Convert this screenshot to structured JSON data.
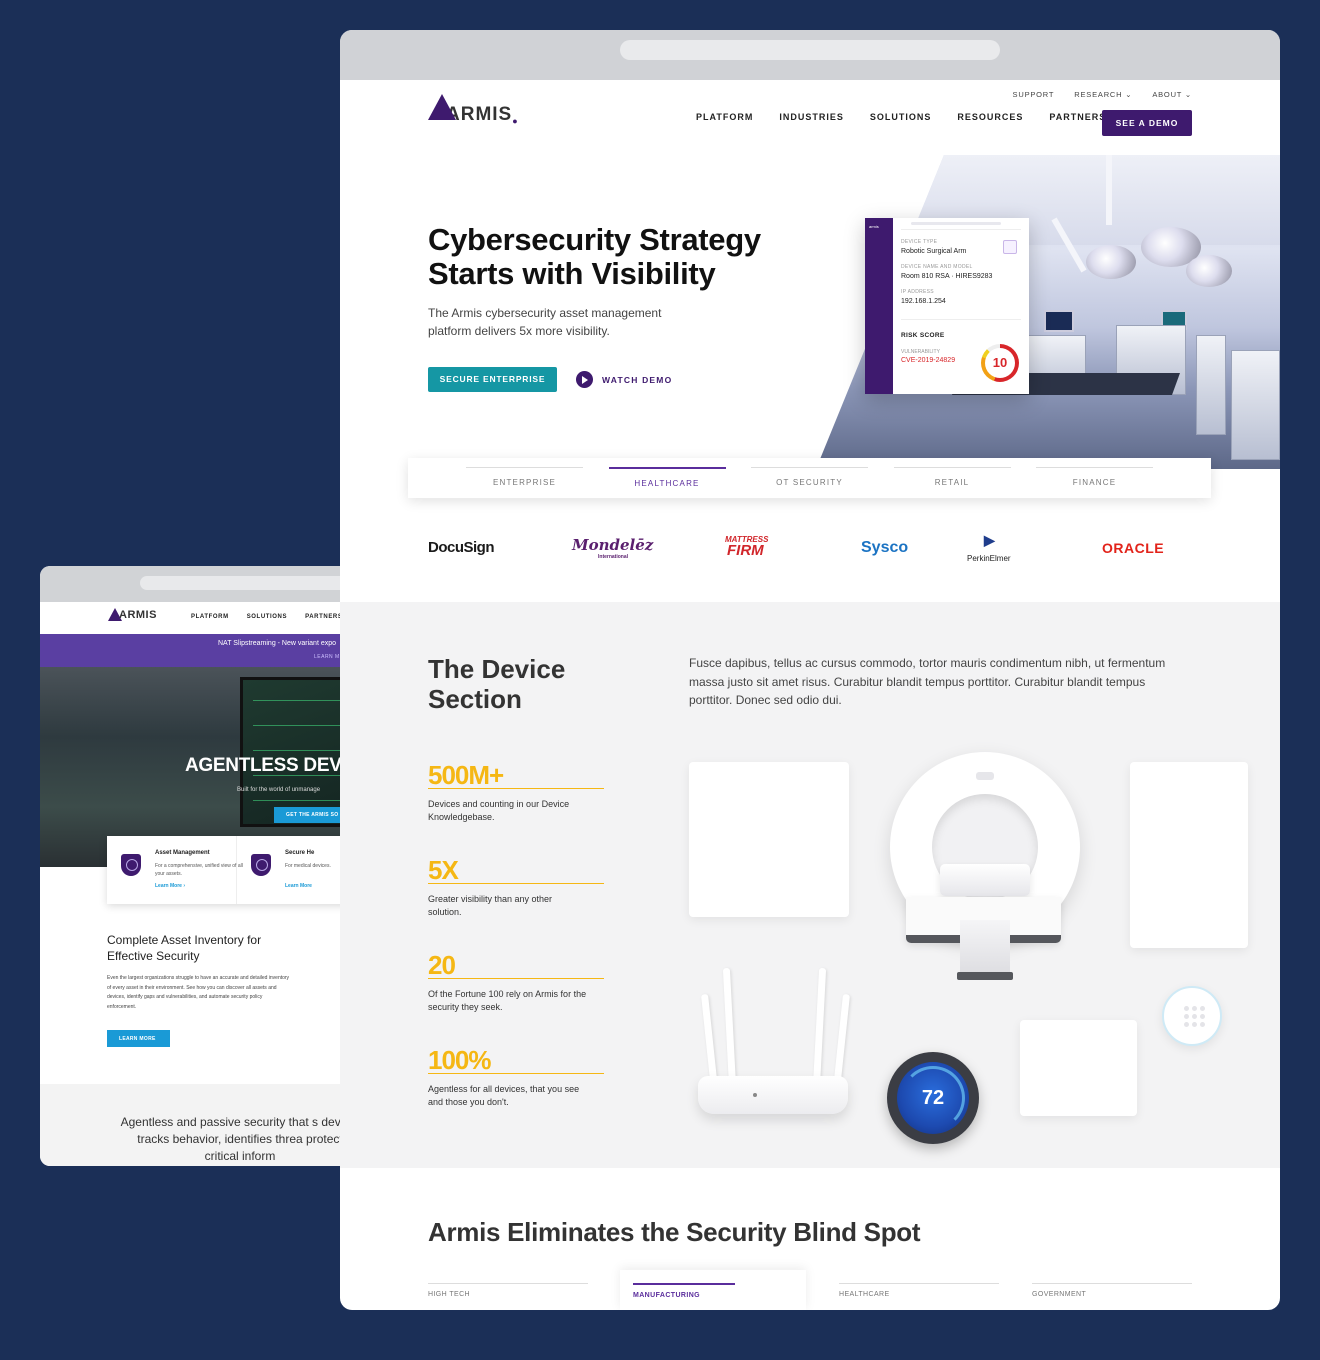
{
  "back_window": {
    "logo": "ARMIS",
    "nav": [
      "PLATFORM",
      "SOLUTIONS",
      "PARTNERS"
    ],
    "banner_text": "NAT Slipstreaming - New variant expo",
    "banner_link": "LEARN M",
    "hero_title": "AGENTLESS DEV",
    "hero_sub": "Built for the world of unmanage",
    "hero_cta": "GET THE ARMIS SO",
    "cards": [
      {
        "title": "Asset Management",
        "desc": "For a comprehensive, unified view of all your assets.",
        "link": "Learn More ›"
      },
      {
        "title": "Secure He",
        "desc": "For medical devices.",
        "link": "Learn More"
      }
    ],
    "body_title": "Complete Asset Inventory for Effective Security",
    "body_text": "Even the largest organizations struggle to have an accurate and detailed inventory of every asset in their environment. See how you can discover all assets and devices, identify gaps and vulnerabilities, and automate security policy enforcement.",
    "body_btn": "LEARN MORE",
    "footer_text": "Agentless and passive security that s device, tracks behavior, identifies threa protect critical inform"
  },
  "header": {
    "logo": "ARMIS",
    "utility": [
      "SUPPORT",
      "RESEARCH ⌄",
      "ABOUT ⌄"
    ],
    "nav": [
      "PLATFORM",
      "INDUSTRIES",
      "SOLUTIONS",
      "RESOURCES",
      "PARTNERS"
    ],
    "demo_button": "SEE A DEMO"
  },
  "hero": {
    "title": "Cybersecurity Strategy Starts with Visibility",
    "description": "The Armis cybersecurity asset management platform delivers 5x more visibility.",
    "primary_button": "SECURE ENTERPRISE",
    "watch_demo": "WATCH DEMO"
  },
  "device_card": {
    "brand": "armis",
    "device_type_label": "DEVICE TYPE",
    "device_type": "Robotic Surgical Arm",
    "name_label": "DEVICE NAME AND MODEL",
    "name": "Room 810 RSA  ·  HIRES9283",
    "ip_label": "IP ADDRESS",
    "ip": "192.168.1.254",
    "risk_label": "RISK SCORE",
    "vuln_label": "VULNERABILITY",
    "vuln": "CVE-2019-24829",
    "score": "10"
  },
  "industry_tabs": [
    "ENTERPRISE",
    "HEALTHCARE",
    "OT SECURITY",
    "RETAIL",
    "FINANCE"
  ],
  "industry_tabs_active": "HEALTHCARE",
  "client_logos": [
    "DocuSign",
    "Mondelēz",
    "International",
    "MATTRESS",
    "FIRM",
    "Sysco",
    "PerkinElmer",
    "ORACLE"
  ],
  "device_section": {
    "title": "The Device Section",
    "paragraph": "Fusce dapibus, tellus ac cursus commodo, tortor mauris condimentum nibh, ut fermentum massa justo sit amet risus. Curabitur blandit tempus porttitor. Curabitur blandit tempus porttitor. Donec sed odio dui.",
    "stats": [
      {
        "value": "500M+",
        "desc": "Devices and counting in our Device Knowledgebase."
      },
      {
        "value": "5X",
        "desc": "Greater visibility than any other solution."
      },
      {
        "value": "20",
        "desc": "Of the Fortune 100 rely on Armis for the security they seek."
      },
      {
        "value": "100%",
        "desc": "Agentless for all devices, that you see and those you don't."
      }
    ],
    "thermostat": "72"
  },
  "eliminates": {
    "title": "Armis Eliminates the Security Blind Spot",
    "tabs": [
      "HIGH TECH",
      "MANUFACTURING",
      "HEALTHCARE",
      "GOVERNMENT"
    ],
    "active": "MANUFACTURING"
  },
  "colors": {
    "background": "#1b2f57",
    "brand_purple": "#3e1a6e",
    "teal": "#1597a4",
    "stat_yellow": "#f5b714",
    "risk_red": "#d8262a"
  }
}
